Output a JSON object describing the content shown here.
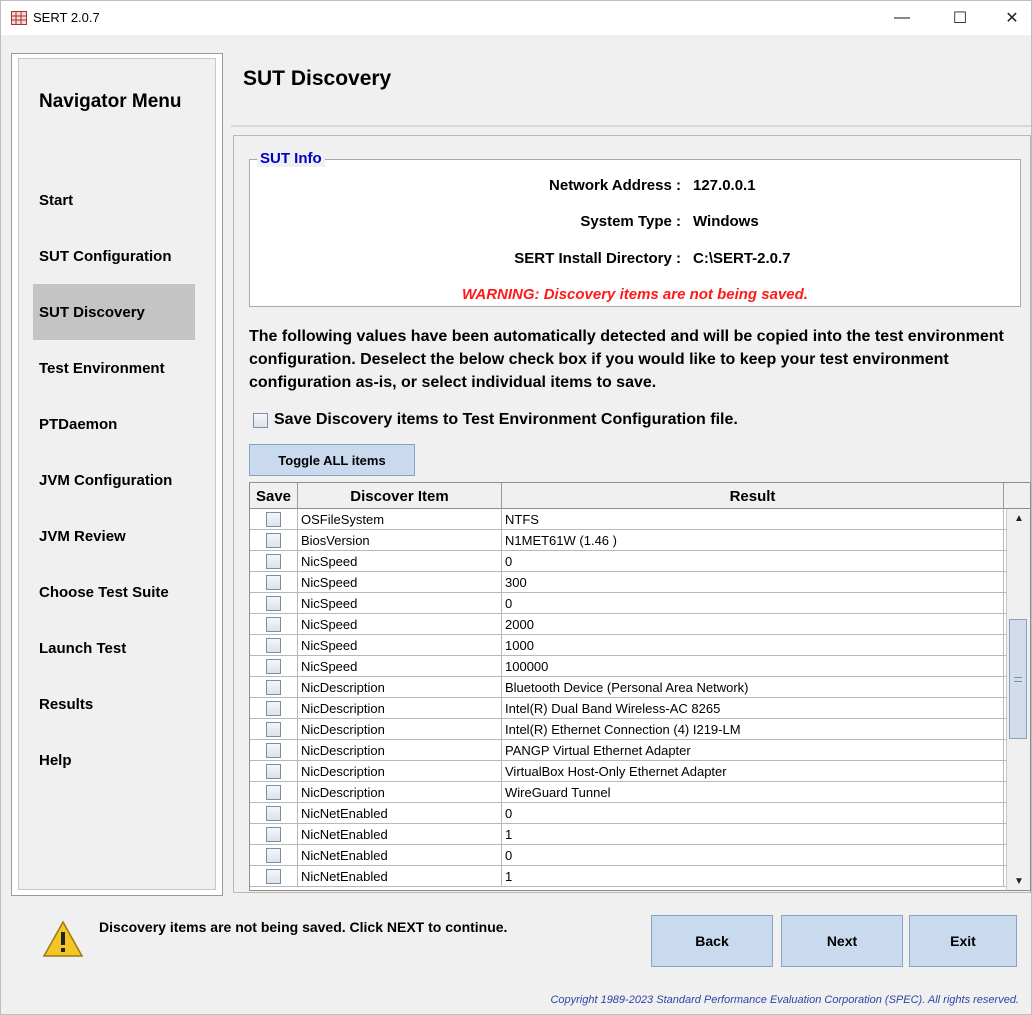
{
  "window": {
    "title": "SERT 2.0.7",
    "minimize_glyph": "—",
    "maximize_glyph": "☐",
    "close_glyph": "✕"
  },
  "nav": {
    "title": "Navigator Menu",
    "items": [
      {
        "label": "Start",
        "selected": false
      },
      {
        "label": "SUT Configuration",
        "selected": false
      },
      {
        "label": "SUT Discovery",
        "selected": true
      },
      {
        "label": "Test Environment",
        "selected": false
      },
      {
        "label": "PTDaemon",
        "selected": false
      },
      {
        "label": "JVM Configuration",
        "selected": false
      },
      {
        "label": "JVM Review",
        "selected": false
      },
      {
        "label": "Choose Test Suite",
        "selected": false
      },
      {
        "label": "Launch Test",
        "selected": false
      },
      {
        "label": "Results",
        "selected": false
      },
      {
        "label": "Help",
        "selected": false
      }
    ]
  },
  "page": {
    "title": "SUT Discovery"
  },
  "sut_info": {
    "legend": "SUT Info",
    "network_address_label": "Network Address :",
    "network_address": "127.0.0.1",
    "system_type_label": "System Type :",
    "system_type": "Windows",
    "install_dir_label": "SERT Install Directory :",
    "install_dir": "C:\\SERT-2.0.7",
    "warning": "WARNING: Discovery items are not being saved."
  },
  "description": "The following values have been automatically detected and will be copied into the test environment configuration. Deselect the below check box if you would like to keep your test environment configuration as-is, or select individual items to save.",
  "save_checkbox": {
    "label": "Save Discovery items to Test Environment Configuration file.",
    "checked": false
  },
  "toggle_button": "Toggle ALL items",
  "table": {
    "headers": [
      "Save",
      "Discover Item",
      "Result"
    ],
    "rows": [
      {
        "item": "OSFileSystem",
        "result": "NTFS"
      },
      {
        "item": "BiosVersion",
        "result": "N1MET61W (1.46 )"
      },
      {
        "item": "NicSpeed",
        "result": "0"
      },
      {
        "item": "NicSpeed",
        "result": "300"
      },
      {
        "item": "NicSpeed",
        "result": "0"
      },
      {
        "item": "NicSpeed",
        "result": "2000"
      },
      {
        "item": "NicSpeed",
        "result": "1000"
      },
      {
        "item": "NicSpeed",
        "result": "100000"
      },
      {
        "item": "NicDescription",
        "result": "Bluetooth Device (Personal Area Network)"
      },
      {
        "item": "NicDescription",
        "result": "Intel(R) Dual Band Wireless-AC 8265"
      },
      {
        "item": "NicDescription",
        "result": "Intel(R) Ethernet Connection (4) I219-LM"
      },
      {
        "item": "NicDescription",
        "result": "PANGP Virtual Ethernet Adapter"
      },
      {
        "item": "NicDescription",
        "result": "VirtualBox Host-Only Ethernet Adapter"
      },
      {
        "item": "NicDescription",
        "result": "WireGuard Tunnel"
      },
      {
        "item": "NicNetEnabled",
        "result": "0"
      },
      {
        "item": "NicNetEnabled",
        "result": "1"
      },
      {
        "item": "NicNetEnabled",
        "result": "0"
      },
      {
        "item": "NicNetEnabled",
        "result": "1"
      }
    ]
  },
  "status": {
    "message": "Discovery items are not being saved. Click NEXT to continue."
  },
  "buttons": {
    "back": "Back",
    "next": "Next",
    "exit": "Exit"
  },
  "footer": {
    "copyright": "Copyright 1989-2023 Standard Performance Evaluation Corporation (SPEC). All rights reserved."
  },
  "colors": {
    "legend_blue": "#0000cc",
    "warning_red": "#ff1a1a",
    "button_fill": "#c9d9ee",
    "selected_nav": "#c4c4c4",
    "copyright_blue": "#2a46a6"
  }
}
